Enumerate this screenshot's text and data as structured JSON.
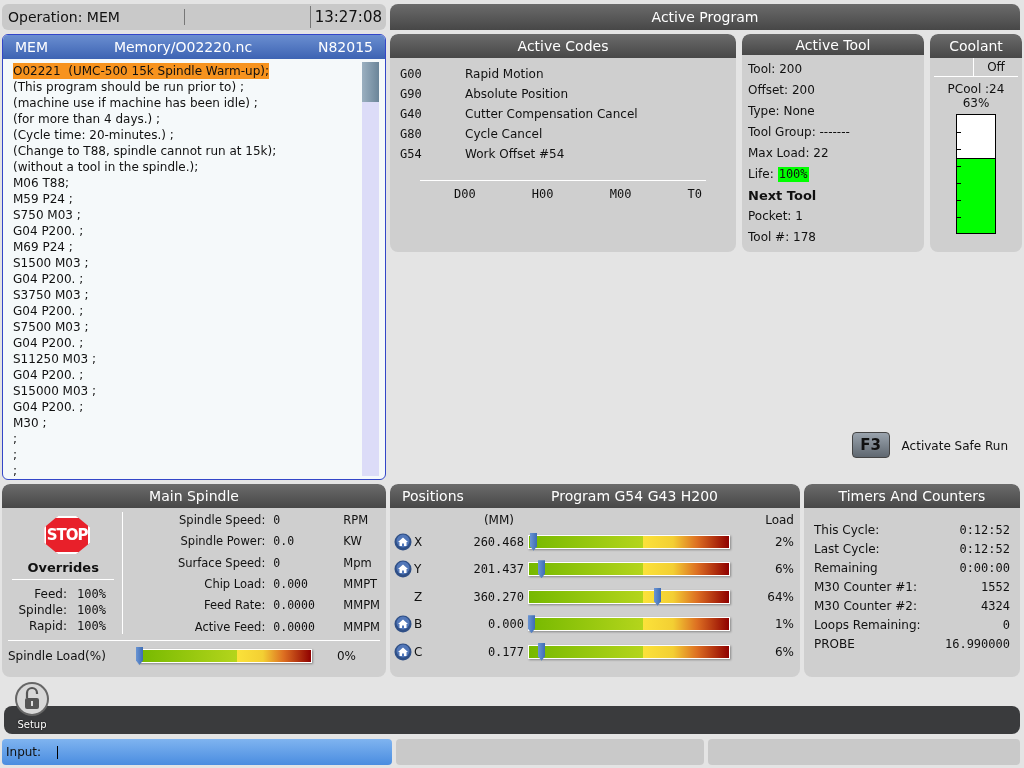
{
  "operation": {
    "label": "Operation: MEM",
    "time": "13:27:08"
  },
  "program": {
    "mode": "MEM",
    "path": "Memory/O02220.nc",
    "line_number": "N82015",
    "lines": [
      {
        "text": "O02221  (UMC-500 15k Spindle Warm-up);",
        "selected": true
      },
      {
        "text": "(This program should be run prior to) ;",
        "selected": false
      },
      {
        "text": "(machine use if machine has been idle) ;",
        "selected": false
      },
      {
        "text": "(for more than 4 days.) ;",
        "selected": false
      },
      {
        "text": "(Cycle time: 20-minutes.) ;",
        "selected": false
      },
      {
        "text": "(Change to T88, spindle cannot run at 15k);",
        "selected": false
      },
      {
        "text": "(without a tool in the spindle.);",
        "selected": false
      },
      {
        "text": "M06 T88;",
        "selected": false
      },
      {
        "text": "M59 P24 ;",
        "selected": false
      },
      {
        "text": "S750 M03 ;",
        "selected": false
      },
      {
        "text": "G04 P200. ;",
        "selected": false
      },
      {
        "text": "M69 P24 ;",
        "selected": false
      },
      {
        "text": "S1500 M03 ;",
        "selected": false
      },
      {
        "text": "G04 P200. ;",
        "selected": false
      },
      {
        "text": "S3750 M03 ;",
        "selected": false
      },
      {
        "text": "G04 P200. ;",
        "selected": false
      },
      {
        "text": "S7500 M03 ;",
        "selected": false
      },
      {
        "text": "G04 P200. ;",
        "selected": false
      },
      {
        "text": "S11250 M03 ;",
        "selected": false
      },
      {
        "text": "G04 P200. ;",
        "selected": false
      },
      {
        "text": "S15000 M03 ;",
        "selected": false
      },
      {
        "text": "G04 P200. ;",
        "selected": false
      },
      {
        "text": "M30 ;",
        "selected": false
      },
      {
        "text": ";",
        "selected": false
      },
      {
        "text": ";",
        "selected": false
      },
      {
        "text": ";",
        "selected": false
      }
    ]
  },
  "active_program": {
    "title": "Active Program"
  },
  "active_codes": {
    "title": "Active Codes",
    "codes": [
      {
        "code": "G00",
        "description": "Rapid Motion"
      },
      {
        "code": "G90",
        "description": "Absolute Position"
      },
      {
        "code": "G40",
        "description": "Cutter Compensation Cancel"
      },
      {
        "code": "G80",
        "description": "Cycle Cancel"
      },
      {
        "code": "G54",
        "description": "Work Offset #54"
      }
    ],
    "footer": [
      "D00",
      "H00",
      "M00",
      "T0"
    ]
  },
  "active_tool": {
    "title": "Active Tool",
    "lines": [
      {
        "kind": "text",
        "text": "Tool: 200"
      },
      {
        "kind": "text",
        "text": "Offset: 200"
      },
      {
        "kind": "text",
        "text": "Type: None"
      },
      {
        "kind": "text",
        "text": "Tool Group: -------"
      },
      {
        "kind": "text",
        "text": "Max Load: 22"
      },
      {
        "kind": "life",
        "text": "Life:",
        "value": "100%",
        "color": "#00ff00"
      },
      {
        "kind": "heading",
        "text": "Next Tool"
      },
      {
        "kind": "text",
        "text": "Pocket: 1"
      },
      {
        "kind": "text",
        "text": "Tool #: 178"
      }
    ]
  },
  "coolant": {
    "title": "Coolant",
    "state": "Off",
    "pcool": "PCool :24",
    "percent": "63%",
    "level": 0.63
  },
  "safe_run": {
    "key": "F3",
    "label": "Activate Safe Run"
  },
  "main_spindle": {
    "title": "Main Spindle",
    "stop": "STOP",
    "overrides_title": "Overrides",
    "overrides": [
      {
        "label": "Feed:",
        "value": "100%"
      },
      {
        "label": "Spindle:",
        "value": "100%"
      },
      {
        "label": "Rapid:",
        "value": "100%"
      }
    ],
    "readings": [
      {
        "label": "Spindle Speed:",
        "value": "0",
        "unit": "RPM"
      },
      {
        "label": "Spindle Power:",
        "value": "0.0",
        "unit": "KW"
      },
      {
        "label": "Surface Speed:",
        "value": "0",
        "unit": "Mpm"
      },
      {
        "label": "Chip Load:",
        "value": "0.000",
        "unit": "MMPT"
      },
      {
        "label": "Feed Rate:",
        "value": "0.0000",
        "unit": "MMPM"
      },
      {
        "label": "Active Feed:",
        "value": "0.0000",
        "unit": "MMPM"
      }
    ],
    "load": {
      "label": "Spindle Load(%)",
      "level": 0,
      "reading": "0%"
    }
  },
  "positions": {
    "title": "Positions",
    "program": "Program G54 G43 H200",
    "units": "(MM)",
    "load_heading": "Load",
    "axes": [
      {
        "axis": "X",
        "home": true,
        "value": "260.468",
        "level": 0.02,
        "reading": "2%"
      },
      {
        "axis": "Y",
        "home": true,
        "value": "201.437",
        "level": 0.06,
        "reading": "6%"
      },
      {
        "axis": "Z",
        "home": false,
        "value": "360.270",
        "level": 0.64,
        "reading": "64%"
      },
      {
        "axis": "B",
        "home": true,
        "value": "0.000",
        "level": 0.01,
        "reading": "1%"
      },
      {
        "axis": "C",
        "home": true,
        "value": "0.177",
        "level": 0.06,
        "reading": "6%"
      }
    ]
  },
  "timers": {
    "title": "Timers And Counters",
    "rows": [
      {
        "label": "This Cycle:",
        "value": "0:12:52"
      },
      {
        "label": "Last Cycle:",
        "value": "0:12:52"
      },
      {
        "label": "Remaining",
        "value": "0:00:00"
      },
      {
        "label": "M30 Counter #1:",
        "value": "1552"
      },
      {
        "label": "M30 Counter #2:",
        "value": "4324"
      },
      {
        "label": "Loops Remaining:",
        "value": "0"
      },
      {
        "label": "PROBE",
        "value": "16.990000"
      }
    ]
  },
  "setup": {
    "label": "Setup"
  },
  "status": {
    "input_label": "Input:"
  }
}
